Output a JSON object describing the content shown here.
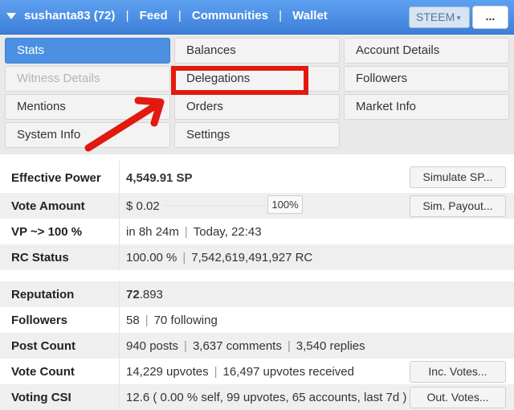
{
  "topbar": {
    "user": "sushanta83 (72)",
    "nav": [
      "Feed",
      "Communities",
      "Wallet"
    ],
    "separator": "|",
    "steem_select": "STEEM",
    "steem_caret": "▼",
    "more_button": "..."
  },
  "menu": {
    "items": [
      {
        "label": "Stats",
        "state": "active"
      },
      {
        "label": "Balances",
        "state": "normal"
      },
      {
        "label": "Account Details",
        "state": "normal"
      },
      {
        "label": "Witness Details",
        "state": "disabled"
      },
      {
        "label": "Delegations",
        "state": "normal"
      },
      {
        "label": "Followers",
        "state": "normal"
      },
      {
        "label": "Mentions",
        "state": "normal"
      },
      {
        "label": "Orders",
        "state": "normal"
      },
      {
        "label": "Market Info",
        "state": "normal"
      },
      {
        "label": "System Info",
        "state": "normal"
      },
      {
        "label": "Settings",
        "state": "normal"
      }
    ],
    "annotation_color": "#e2190f"
  },
  "stats": {
    "effective_power": {
      "label": "Effective Power",
      "value": "4,549.91 SP",
      "button": "Simulate SP..."
    },
    "vote_amount": {
      "label": "Vote Amount",
      "value": "$ 0.02",
      "percent": "100%",
      "slider_fraction": 1.0,
      "button": "Sim. Payout..."
    },
    "vp": {
      "label": "VP ~> 100 %",
      "time": "in 8h 24m",
      "when": "Today, 22:43"
    },
    "rc_status": {
      "label": "RC Status",
      "percent": "100.00 %",
      "rc": "7,542,619,491,927 RC"
    },
    "reputation": {
      "label": "Reputation",
      "value_bold": "72",
      "value_rest": ".893"
    },
    "followers": {
      "label": "Followers",
      "count": "58",
      "following": "70 following"
    },
    "post_count": {
      "label": "Post Count",
      "posts": "940 posts",
      "comments": "3,637 comments",
      "replies": "3,540 replies"
    },
    "vote_count": {
      "label": "Vote Count",
      "upvotes": "14,229 upvotes",
      "received": "16,497 upvotes received",
      "button": "Inc. Votes..."
    },
    "voting_csi": {
      "label": "Voting CSI",
      "value": "12.6 ( 0.00 % self, 99 upvotes, 65 accounts, last 7d )",
      "button": "Out. Votes..."
    },
    "separator": "|"
  },
  "colors": {
    "topbar": "#4a8de6",
    "active": "#4b90e2",
    "annotation": "#e2190f"
  }
}
